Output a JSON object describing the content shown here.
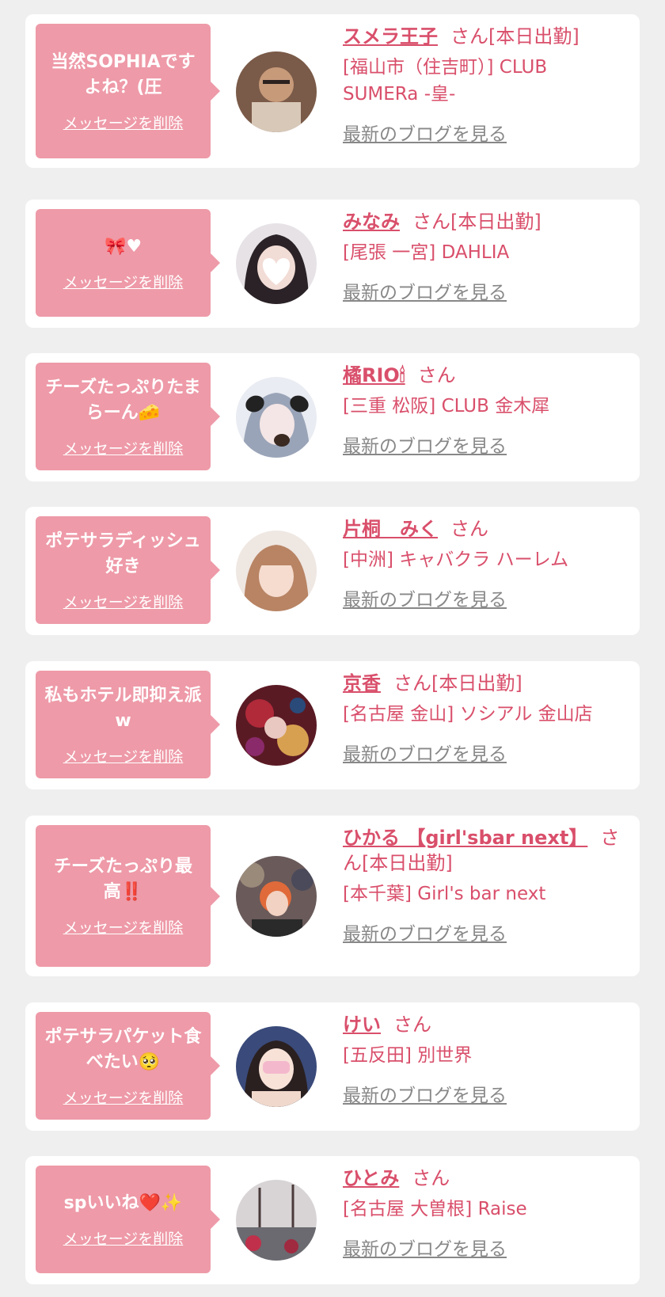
{
  "items": [
    {
      "message": "当然SOPHIAですよね？(圧",
      "delete_label": "メッセージを削除",
      "name": "スメラ王子",
      "suffix": "さん[本日出勤]",
      "shop": "[福山市（住吉町）] CLUB SUMERa -皇-",
      "blog_label": "最新のブログを見る",
      "avatar_icon": "photo-avatar"
    },
    {
      "message": "🎀♥",
      "delete_label": "メッセージを削除",
      "name": "みなみ",
      "suffix": "さん[本日出勤]",
      "shop": "[尾張 一宮] DAHLIA",
      "blog_label": "最新のブログを見る",
      "avatar_icon": "photo-avatar"
    },
    {
      "message": "チーズたっぷりたまらーん🧀",
      "delete_label": "メッセージを削除",
      "name": "橘RIO🕯",
      "suffix": "さん",
      "shop": "[三重 松阪] CLUB 金木犀",
      "blog_label": "最新のブログを見る",
      "avatar_icon": "photo-avatar"
    },
    {
      "message": "ポテサラディッシュ好き",
      "delete_label": "メッセージを削除",
      "name": "片桐　みく",
      "suffix": "さん",
      "shop": "[中洲] キャバクラ ハーレム",
      "blog_label": "最新のブログを見る",
      "avatar_icon": "photo-avatar"
    },
    {
      "message": "私もホテル即抑え派w",
      "delete_label": "メッセージを削除",
      "name": "京香",
      "suffix": "さん[本日出勤]",
      "shop": "[名古屋 金山] ソシアル 金山店",
      "blog_label": "最新のブログを見る",
      "avatar_icon": "photo-avatar"
    },
    {
      "message": "チーズたっぷり最高‼️",
      "delete_label": "メッセージを削除",
      "name": "ひかる 【girl'sbar next】",
      "suffix": "さん[本日出勤]",
      "shop": "[本千葉] Girl's bar next",
      "blog_label": "最新のブログを見る",
      "avatar_icon": "photo-avatar"
    },
    {
      "message": "ポテサラパケット食べたい🥺",
      "delete_label": "メッセージを削除",
      "name": "けい",
      "suffix": "さん",
      "shop": "[五反田] 別世界",
      "blog_label": "最新のブログを見る",
      "avatar_icon": "photo-avatar"
    },
    {
      "message": "spいいね❤️✨",
      "delete_label": "メッセージを削除",
      "name": "ひとみ",
      "suffix": "さん",
      "shop": "[名古屋 大曽根] Raise",
      "blog_label": "最新のブログを見る",
      "avatar_icon": "photo-avatar"
    }
  ],
  "colors": {
    "page_bg": "#efefef",
    "card_bg": "#ffffff",
    "bubble_bg": "#ee9aa8",
    "accent_text": "#d94f6b",
    "muted_link": "#888888"
  }
}
